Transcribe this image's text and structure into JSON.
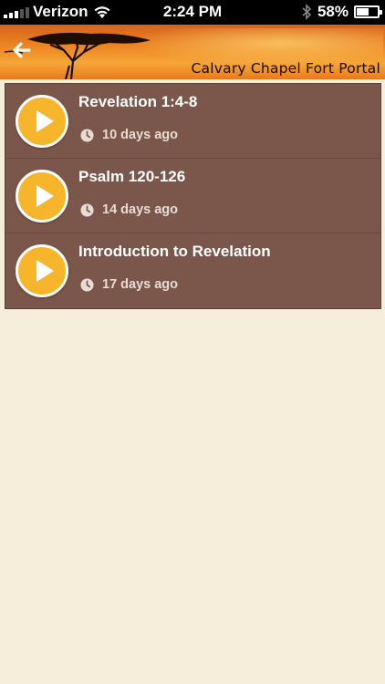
{
  "status_bar": {
    "carrier": "Verizon",
    "time": "2:24 PM",
    "battery": "58%",
    "battery_level": 0.58,
    "signal_bars": 3
  },
  "header": {
    "title": "Calvary Chapel Fort Portal",
    "back_icon": "arrow-left-icon"
  },
  "sermons": [
    {
      "title": "Revelation 1:4-8",
      "age": "10 days ago"
    },
    {
      "title": "Psalm 120-126",
      "age": "14 days ago"
    },
    {
      "title": "Introduction to Revelation",
      "age": "17 days ago"
    }
  ],
  "colors": {
    "background": "#f6eedb",
    "list_bg": "#7a574a",
    "play_button": "#f7b52c",
    "header_orange": "#ef8b25"
  }
}
